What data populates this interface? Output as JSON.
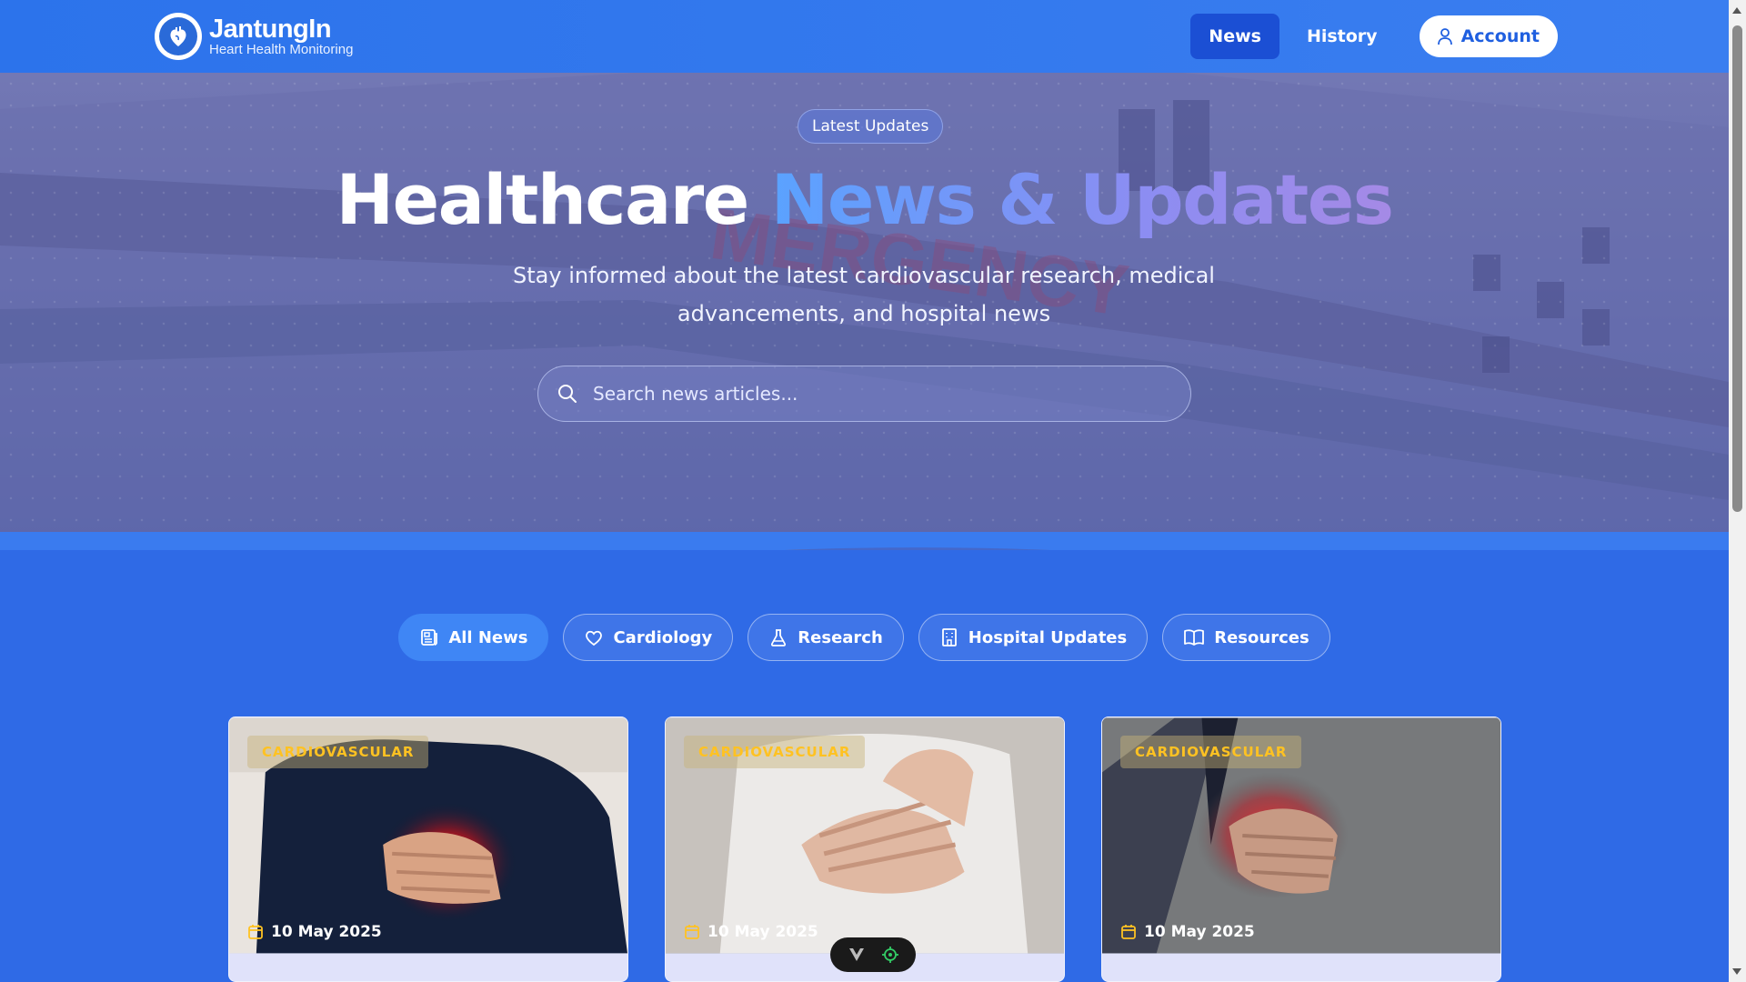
{
  "header": {
    "brand": "JantungIn",
    "tagline": "Heart Health Monitoring",
    "nav": {
      "news": "News",
      "history": "History",
      "account": "Account"
    }
  },
  "hero": {
    "badge": "Latest Updates",
    "title_plain": "Healthcare",
    "title_highlight": "News & Updates",
    "subtitle": "Stay informed about the latest cardiovascular research, medical advancements, and hospital news",
    "search_placeholder": "Search news articles..."
  },
  "filters": [
    {
      "label": "All News",
      "icon": "newspaper-icon",
      "active": true
    },
    {
      "label": "Cardiology",
      "icon": "heart-icon",
      "active": false
    },
    {
      "label": "Research",
      "icon": "flask-icon",
      "active": false
    },
    {
      "label": "Hospital Updates",
      "icon": "hospital-icon",
      "active": false
    },
    {
      "label": "Resources",
      "icon": "book-icon",
      "active": false
    }
  ],
  "cards": [
    {
      "tag": "CARDIOVASCULAR",
      "date": "10 May 2025"
    },
    {
      "tag": "CARDIOVASCULAR",
      "date": "10 May 2025"
    },
    {
      "tag": "CARDIOVASCULAR",
      "date": "10 May 2025"
    }
  ],
  "colors": {
    "primary": "#2f6ae6",
    "nav_active": "#1b4fd4",
    "tag": "#ffc222",
    "chip_active": "#3f86f5"
  }
}
